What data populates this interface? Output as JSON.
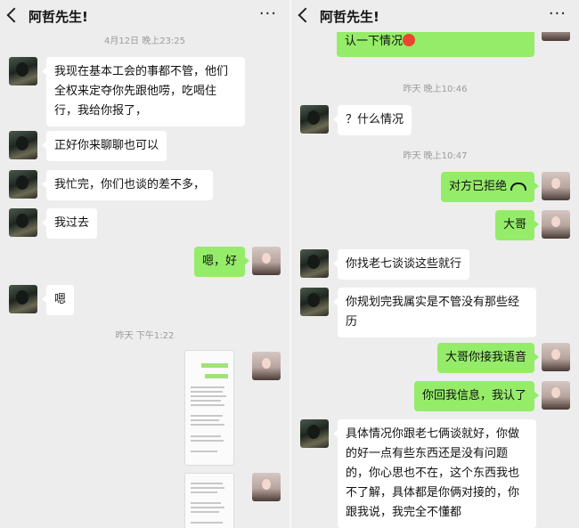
{
  "left": {
    "title": "阿哲先生!",
    "more": "···",
    "messages": [
      {
        "type": "time",
        "text": "4月12日 晚上23:25"
      },
      {
        "type": "in",
        "text": "我现在基本工会的事都不管，他们全权来定夺你先跟他唠，吃喝住行，我给你报了，"
      },
      {
        "type": "in",
        "text": "正好你来聊聊也可以"
      },
      {
        "type": "in",
        "text": "我忙完，你们也谈的差不多，"
      },
      {
        "type": "in",
        "text": "我过去"
      },
      {
        "type": "out",
        "text": "嗯，好"
      },
      {
        "type": "in",
        "text": "嗯"
      },
      {
        "type": "time",
        "text": "昨天 下午1:22"
      }
    ]
  },
  "right": {
    "title": "阿哲先生!",
    "more": "···",
    "messages": [
      {
        "type": "out",
        "text": "抱歉老大，阿姨生病打扰你，您确认一下情况"
      },
      {
        "type": "time",
        "text": "昨天 晚上10:46"
      },
      {
        "type": "in",
        "text": "？什么情况"
      },
      {
        "type": "time",
        "text": "昨天 晚上10:47"
      },
      {
        "type": "out",
        "text": "对方已拒绝"
      },
      {
        "type": "out",
        "text": "大哥"
      },
      {
        "type": "in",
        "text": "你找老七谈谈这些就行"
      },
      {
        "type": "in",
        "text": "你规划完我属实是不管没有那些经历"
      },
      {
        "type": "out",
        "text": "大哥你接我语音"
      },
      {
        "type": "out",
        "text": "你回我信息，我认了"
      },
      {
        "type": "in",
        "text": "具体情况你跟老七俩谈就好，你做的好一点有些东西还是没有问题的，你心思也不在，这个东西我也不了解，具体都是你俩对接的，你跟我说，我完全不懂都"
      }
    ]
  },
  "colors": {
    "background": "#ededed",
    "incoming": "#ffffff",
    "outgoing": "#95ec69",
    "timestamp": "#9b9b9b"
  },
  "icons": [
    "back-arrow-icon",
    "more-icon",
    "voice-call-declined-icon",
    "angry-face-emoji"
  ]
}
